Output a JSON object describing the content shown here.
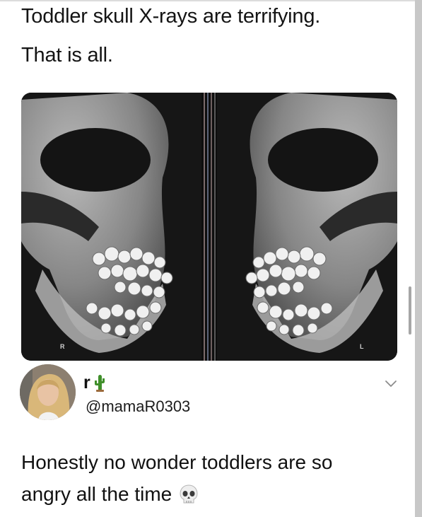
{
  "post": {
    "caption_line1": "Toddler skull X-rays are terrifying.",
    "caption_line2": "That is all."
  },
  "xray": {
    "left_marker": "R",
    "right_marker": "L"
  },
  "tweet": {
    "display_name": "r",
    "name_emoji_icon": "cactus-icon",
    "handle": "@mamaR0303",
    "text_line1": "Honestly no wonder toddlers are so",
    "text_line2": "angry all the time",
    "text_emoji_icon": "skull-icon",
    "menu_icon": "chevron-down-icon"
  },
  "colors": {
    "background": "#ffffff",
    "text": "#141414",
    "xray_background": "#151515",
    "cactus": "#3f8f2a"
  }
}
